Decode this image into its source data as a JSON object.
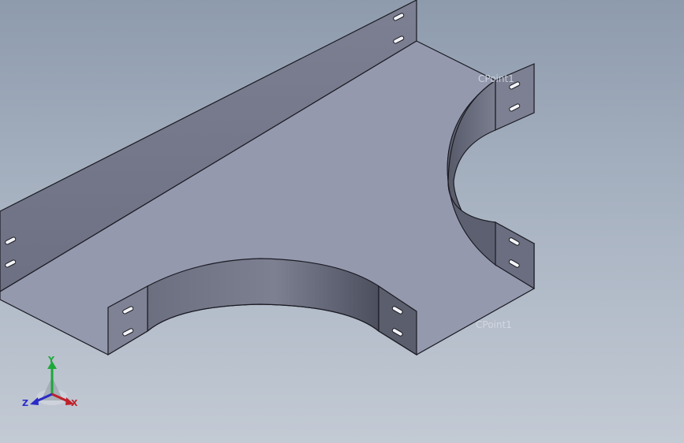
{
  "viewport": {
    "background_top": "#8e9bad",
    "background_bottom": "#c3cad4",
    "part_color": "#959bb0"
  },
  "labels": {
    "cpoint_top_right": "CPoint1",
    "cpoint_bottom_right": "CPoint1"
  },
  "triad": {
    "x_label": "X",
    "y_label": "Y",
    "z_label": "Z",
    "x_color": "#c0202a",
    "y_color": "#1ea83a",
    "z_color": "#2a2ac8"
  }
}
